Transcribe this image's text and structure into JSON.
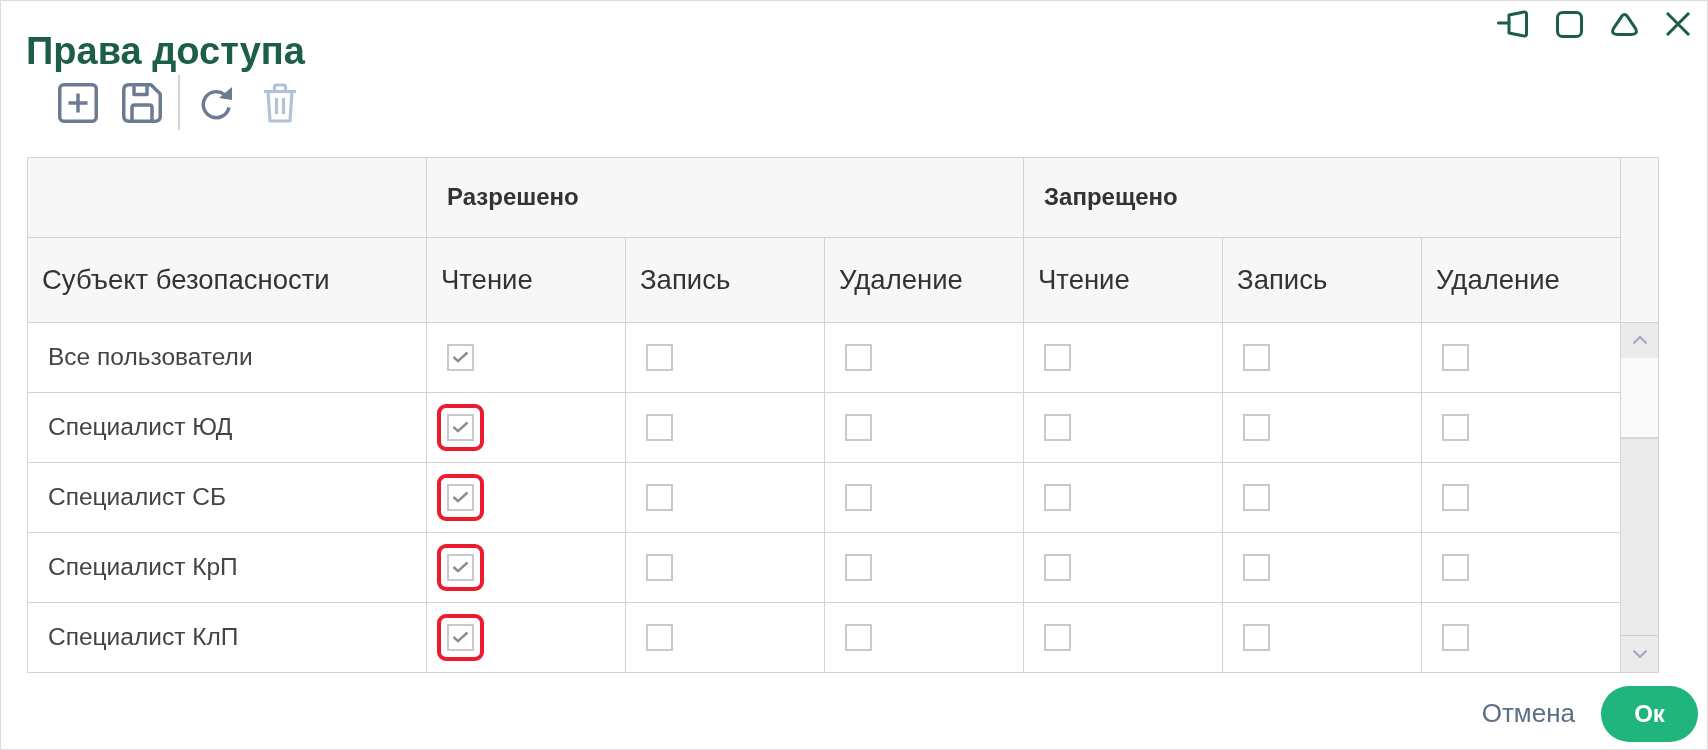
{
  "window": {
    "title": "Права доступа"
  },
  "toolbar": {
    "add": {
      "disabled": false
    },
    "save": {
      "disabled": false
    },
    "refresh": {
      "disabled": false
    },
    "delete": {
      "disabled": true
    }
  },
  "table": {
    "subject_column": "Субъект безопасности",
    "column_groups": [
      {
        "label": "Разрешено",
        "columns": [
          "Чтение",
          "Запись",
          "Удаление"
        ]
      },
      {
        "label": "Запрещено",
        "columns": [
          "Чтение",
          "Запись",
          "Удаление"
        ]
      }
    ],
    "rows": [
      {
        "subject": "Все пользователи",
        "cells": [
          {
            "checked": true,
            "highlighted": false
          },
          {
            "checked": false,
            "highlighted": false
          },
          {
            "checked": false,
            "highlighted": false
          },
          {
            "checked": false,
            "highlighted": false
          },
          {
            "checked": false,
            "highlighted": false
          },
          {
            "checked": false,
            "highlighted": false
          }
        ]
      },
      {
        "subject": "Специалист ЮД",
        "cells": [
          {
            "checked": true,
            "highlighted": true
          },
          {
            "checked": false,
            "highlighted": false
          },
          {
            "checked": false,
            "highlighted": false
          },
          {
            "checked": false,
            "highlighted": false
          },
          {
            "checked": false,
            "highlighted": false
          },
          {
            "checked": false,
            "highlighted": false
          }
        ]
      },
      {
        "subject": "Специалист СБ",
        "cells": [
          {
            "checked": true,
            "highlighted": true
          },
          {
            "checked": false,
            "highlighted": false
          },
          {
            "checked": false,
            "highlighted": false
          },
          {
            "checked": false,
            "highlighted": false
          },
          {
            "checked": false,
            "highlighted": false
          },
          {
            "checked": false,
            "highlighted": false
          }
        ]
      },
      {
        "subject": "Специалист КрП",
        "cells": [
          {
            "checked": true,
            "highlighted": true
          },
          {
            "checked": false,
            "highlighted": false
          },
          {
            "checked": false,
            "highlighted": false
          },
          {
            "checked": false,
            "highlighted": false
          },
          {
            "checked": false,
            "highlighted": false
          },
          {
            "checked": false,
            "highlighted": false
          }
        ]
      },
      {
        "subject": "Специалист КлП",
        "cells": [
          {
            "checked": true,
            "highlighted": true
          },
          {
            "checked": false,
            "highlighted": false
          },
          {
            "checked": false,
            "highlighted": false
          },
          {
            "checked": false,
            "highlighted": false
          },
          {
            "checked": false,
            "highlighted": false
          },
          {
            "checked": false,
            "highlighted": false
          }
        ]
      }
    ]
  },
  "footer": {
    "cancel_button": "Отмена",
    "ok_button": "Ок"
  }
}
